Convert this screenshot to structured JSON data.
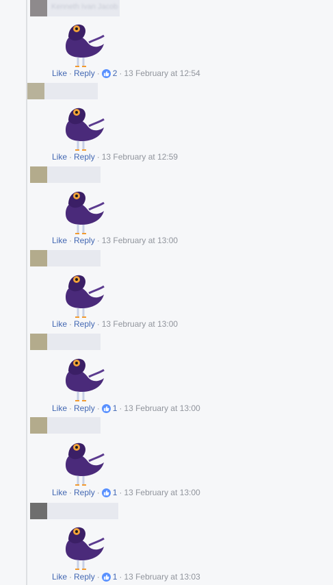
{
  "actions": {
    "like_label": "Like",
    "reply_label": "Reply",
    "separator": "·"
  },
  "comments": [
    {
      "author_blurred": "Kenneth Ivan Jacob",
      "avatar_color": "#8e8a8c",
      "sticker": "purple-pigeon-sticker",
      "reactions": "2",
      "timestamp": "13 February at 12:54"
    },
    {
      "author_blurred": "",
      "avatar_color": "#b8b29a",
      "sticker": "purple-pigeon-sticker",
      "reactions": "",
      "timestamp": "13 February at 12:59"
    },
    {
      "author_blurred": "",
      "avatar_color": "#b3ab8c",
      "sticker": "purple-pigeon-sticker",
      "reactions": "",
      "timestamp": "13 February at 13:00"
    },
    {
      "author_blurred": "",
      "avatar_color": "#b3ab8c",
      "sticker": "purple-pigeon-sticker",
      "reactions": "",
      "timestamp": "13 February at 13:00"
    },
    {
      "author_blurred": "",
      "avatar_color": "#b3ab8c",
      "sticker": "purple-pigeon-sticker",
      "reactions": "1",
      "timestamp": "13 February at 13:00"
    },
    {
      "author_blurred": "",
      "avatar_color": "#b3ab8c",
      "sticker": "purple-pigeon-sticker",
      "reactions": "1",
      "timestamp": "13 February at 13:00"
    },
    {
      "author_blurred": "",
      "avatar_color": "#6e6e6e",
      "sticker": "purple-pigeon-sticker",
      "reactions": "1",
      "timestamp": "13 February at 13:03"
    }
  ],
  "colors": {
    "link": "#4267b2",
    "meta": "#90949c",
    "like_badge": "#5890ff",
    "pigeon_body": "#4a2a7a"
  }
}
